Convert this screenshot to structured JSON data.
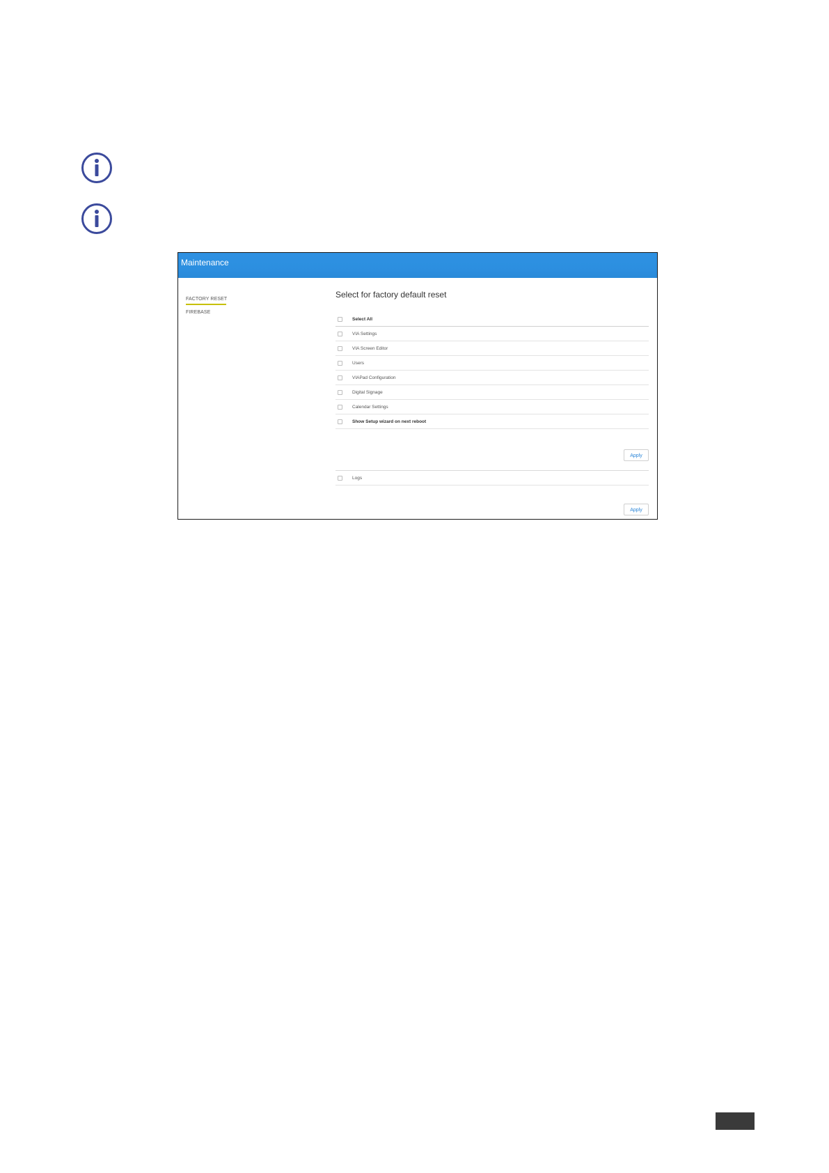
{
  "icons": [
    "info-icon",
    "info-icon"
  ],
  "header": {
    "title": "Maintenance"
  },
  "sidebar": {
    "items": [
      {
        "label": "FACTORY RESET"
      },
      {
        "label": "FIREBASE"
      }
    ]
  },
  "main": {
    "title": "Select for factory default reset",
    "options": [
      {
        "label": "Select All",
        "bold": true
      },
      {
        "label": "VIA Settings"
      },
      {
        "label": "VIA Screen Editor"
      },
      {
        "label": "Users"
      },
      {
        "label": "VIAPad Configuration"
      },
      {
        "label": "Digital Signage"
      },
      {
        "label": "Calendar Settings"
      },
      {
        "label": "Show Setup wizard on next reboot",
        "bold": true
      }
    ],
    "apply_label": "Apply",
    "logs_label": "Logs",
    "logs_apply_label": "Apply"
  },
  "colors": {
    "header_blue": "#2c8fe0",
    "active_underline": "#c7c000",
    "icon_color": "#3b4a9c",
    "apply_text": "#2a85d8"
  }
}
